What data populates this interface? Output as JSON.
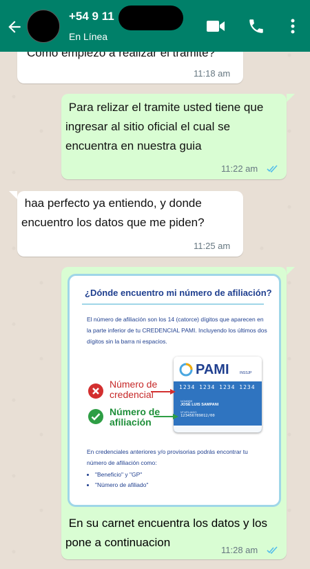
{
  "header": {
    "contact_name": "+54 9 11",
    "status": "En Línea",
    "accent": "#008069"
  },
  "messages": [
    {
      "direction": "incoming",
      "text": "Como empiezo a realizar el tramite?",
      "time": "11:18 am"
    },
    {
      "direction": "outgoing",
      "text": " Para relizar el tramite usted tiene que ingresar al sitio oficial el cual se encuentra en nuestra guia",
      "time": "11:22 am",
      "read": true
    },
    {
      "direction": "incoming",
      "text": " haa perfecto ya entiendo, y donde encuentro los datos que me piden?",
      "time": "11:25 am"
    },
    {
      "direction": "outgoing",
      "text": " En su carnet encuentra los datos y los pone a continuacion",
      "time": "11:28 am",
      "read": true,
      "image": {
        "title": "¿Dónde encuentro mi número de afiliación?",
        "paragraph1": "El número de afiliación son los 14 (catorce) dígitos que aparecen en la parte inferior de tu CREDENCIAL PAMI. Incluyendo los últimos dos dígitos sin la barra ni espacios.",
        "card_brand": "PAMI",
        "card_sub": "INSSJP",
        "card_number": "1234 1234 1234 1234",
        "holder_label": "NOMBRE",
        "holder_name": "JOSÉ LUIS SAMPANI",
        "affiliate_label": "Nº AFILIADO",
        "affiliate_number": "123456789012/00",
        "label_credential": "Número de credencial",
        "label_affiliation": "Número de afiliación",
        "paragraph2": "En credenciales anteriores y/o provisorias podrás encontrar tu número de afiliación como:",
        "list": [
          "\"Beneficio\" y \"GP\"",
          "\"Número de afiliado\""
        ]
      }
    }
  ],
  "colors": {
    "outgoing_bubble": "#d9fdd3",
    "incoming_bubble": "#ffffff",
    "read_ticks": "#53bdeb"
  }
}
